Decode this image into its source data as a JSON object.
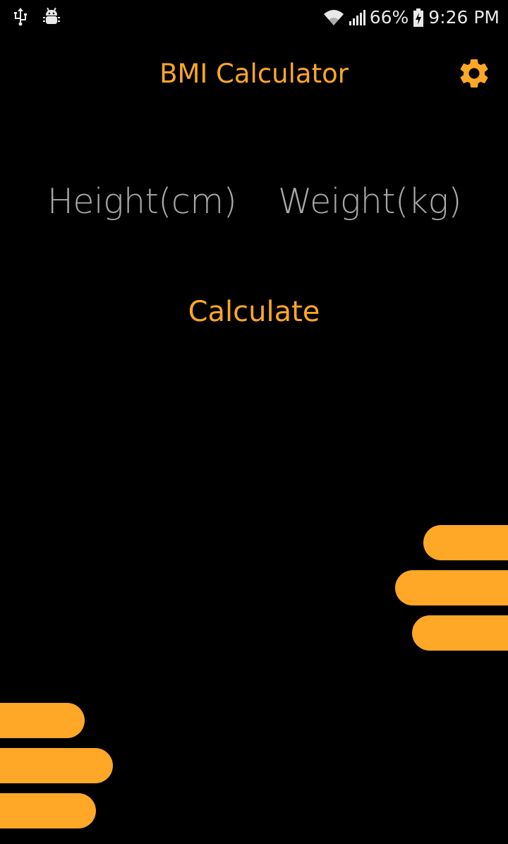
{
  "status_bar": {
    "icons": [
      "usb-icon",
      "android-debug-icon",
      "wifi-icon",
      "signal-icon",
      "battery-charging-icon"
    ],
    "battery_percent": "66%",
    "time": "9:26 PM"
  },
  "app_bar": {
    "title": "BMI Calculator",
    "settings_icon": "gear-icon"
  },
  "inputs": {
    "height": {
      "value": "",
      "placeholder": "Height(cm)"
    },
    "weight": {
      "value": "",
      "placeholder": "Weight(kg)"
    }
  },
  "actions": {
    "calculate_label": "Calculate"
  },
  "colors": {
    "background": "#000000",
    "accent": "#ffa726",
    "placeholder": "#a8a8a8",
    "status_text": "#e9e9e9"
  }
}
